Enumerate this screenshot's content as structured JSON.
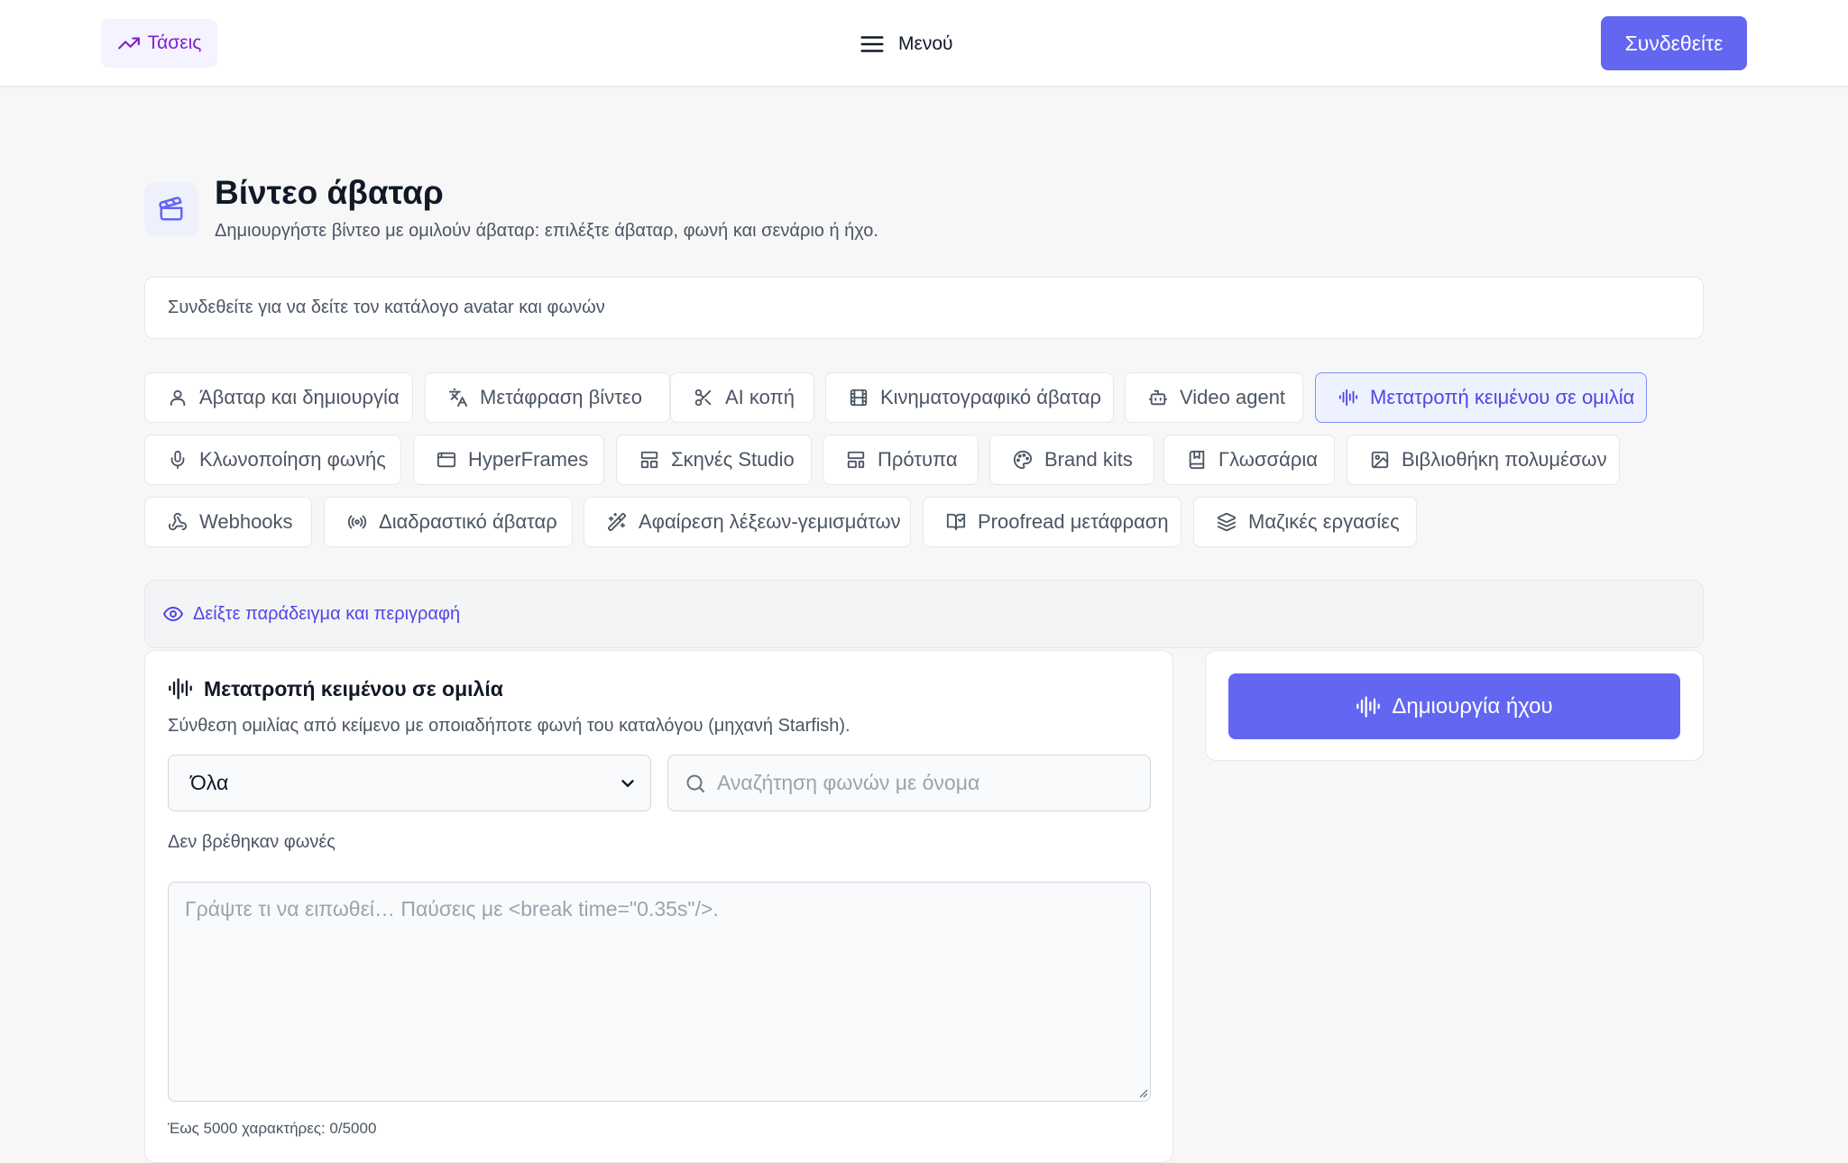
{
  "header": {
    "trends_label": "Τάσεις",
    "menu_label": "Μενού",
    "login_label": "Συνδεθείτε"
  },
  "page": {
    "title": "Βίντεο άβαταρ",
    "subtitle": "Δημιουργήστε βίντεο με ομιλούν άβαταρ: επιλέξτε άβαταρ, φωνή και σενάριο ή ήχο.",
    "notice": "Συνδεθείτε για να δείτε τον κατάλογο avatar και φωνών"
  },
  "tabs": [
    {
      "label": "Άβαταρ και δημιουργία",
      "icon": "user-icon"
    },
    {
      "label": "Μετάφραση βίντεο",
      "icon": "translate-icon"
    },
    {
      "label": "AI κοπή",
      "icon": "scissors-icon"
    },
    {
      "label": "Κινηματογραφικό άβαταρ",
      "icon": "film-icon"
    },
    {
      "label": "Video agent",
      "icon": "bot-icon"
    },
    {
      "label": "Μετατροπή κειμένου σε ομιλία",
      "icon": "audio-waveform-icon",
      "active": true
    },
    {
      "label": "Κλωνοποίηση φωνής",
      "icon": "microphone-icon"
    },
    {
      "label": "HyperFrames",
      "icon": "app-window-icon"
    },
    {
      "label": "Σκηνές Studio",
      "icon": "layout-icon"
    },
    {
      "label": "Πρότυπα",
      "icon": "template-icon"
    },
    {
      "label": "Brand kits",
      "icon": "palette-icon"
    },
    {
      "label": "Γλωσσάρια",
      "icon": "book-icon"
    },
    {
      "label": "Βιβλιοθήκη πολυμέσων",
      "icon": "image-icon"
    },
    {
      "label": "Webhooks",
      "icon": "webhook-icon"
    },
    {
      "label": "Διαδραστικό άβαταρ",
      "icon": "radio-icon"
    },
    {
      "label": "Αφαίρεση λέξεων-γεμισμάτων",
      "icon": "wand-icon"
    },
    {
      "label": "Proofread μετάφραση",
      "icon": "book-check-icon"
    },
    {
      "label": "Μαζικές εργασίες",
      "icon": "layers-icon"
    }
  ],
  "example_toggle": "Δείξτε παράδειγμα και περιγραφή",
  "tts": {
    "heading": "Μετατροπή κειμένου σε ομιλία",
    "description": "Σύνθεση ομιλίας από κείμενο με οποιαδήποτε φωνή του καταλόγου (μηχανή Starfish).",
    "filter_selected": "Όλα",
    "search_placeholder": "Αναζήτηση φωνών με όνομα",
    "no_voices": "Δεν βρέθηκαν φωνές",
    "text_placeholder": "Γράψτε τι να ειπωθεί… Παύσεις με <break time=\"0.35s\"/>.",
    "char_count": "Έως 5000 χαρακτήρες: 0/5000"
  },
  "generate_label": "Δημιουργία ήχου",
  "colors": {
    "accent": "#6366f1",
    "accent_text": "#4f46e5",
    "trends": "#7e22ce",
    "background": "#f7f7f8"
  }
}
